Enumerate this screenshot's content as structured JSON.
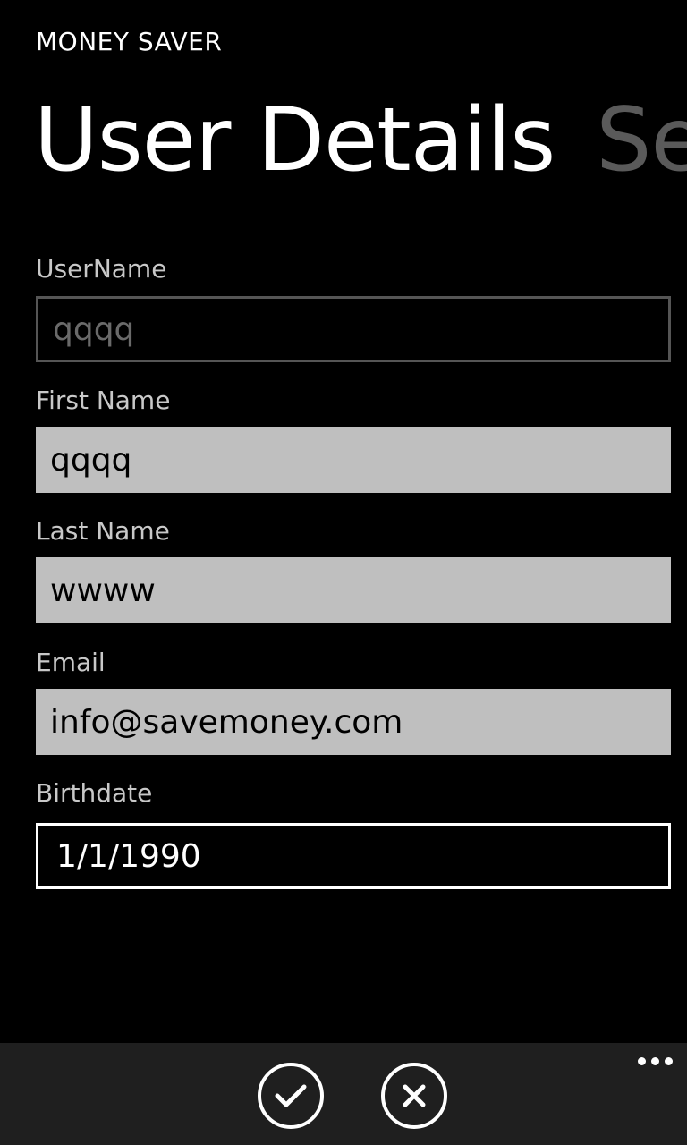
{
  "app": {
    "title": "MONEY SAVER"
  },
  "pivot": {
    "current": "User Details",
    "next": "Se"
  },
  "fields": {
    "username": {
      "label": "UserName",
      "value": "qqqq"
    },
    "first_name": {
      "label": "First Name",
      "value": "qqqq"
    },
    "last_name": {
      "label": "Last Name",
      "value": "wwww"
    },
    "email": {
      "label": "Email",
      "value": "info@savemoney.com"
    },
    "birthdate": {
      "label": "Birthdate",
      "value": "1/1/1990"
    }
  },
  "appbar": {
    "buttons": [
      {
        "icon": "check-icon"
      },
      {
        "icon": "close-icon"
      }
    ],
    "more_icon": "ellipsis-icon"
  }
}
